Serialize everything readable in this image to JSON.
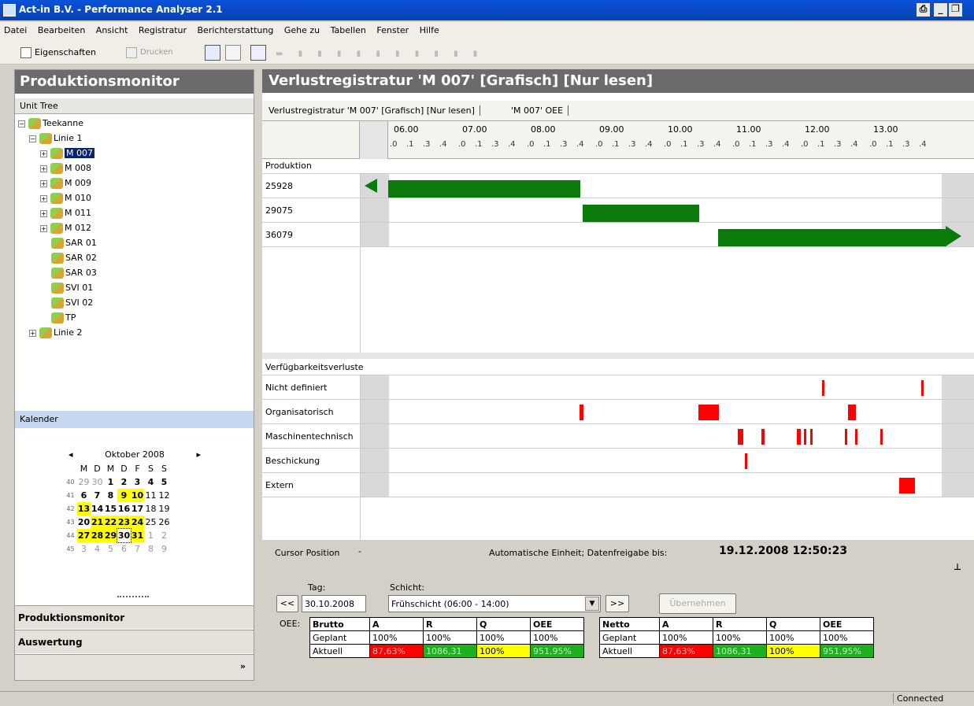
{
  "window": {
    "title": "Act-in B.V. - Performance Analyser 2.1"
  },
  "menu": [
    "Datei",
    "Bearbeiten",
    "Ansicht",
    "Registratur",
    "Berichterstattung",
    "Gehe zu",
    "Tabellen",
    "Fenster",
    "Hilfe"
  ],
  "toolbar": {
    "properties": "Eigenschaften",
    "print": "Drucken"
  },
  "left": {
    "title": "Produktionsmonitor",
    "unit_tree": "Unit Tree",
    "tree": {
      "root": "Teekanne",
      "linie1": "Linie 1",
      "items": [
        "M 007",
        "M 008",
        "M 009",
        "M 010",
        "M 011",
        "M 012",
        "SAR 01",
        "SAR 02",
        "SAR 03",
        "SVI 01",
        "SVI 02",
        "TP"
      ],
      "linie2": "Linie 2"
    },
    "kalender": "Kalender",
    "month": "Oktober 2008",
    "weekdays": [
      "M",
      "D",
      "M",
      "D",
      "F",
      "S",
      "S"
    ],
    "weeks": [
      "40",
      "41",
      "42",
      "43",
      "44",
      "45"
    ],
    "nav1": "Produktionsmonitor",
    "nav2": "Auswertung"
  },
  "right": {
    "title": "Verlustregistratur 'M 007' [Grafisch] [Nur lesen]",
    "tab1": "Verlustregistratur 'M 007' [Grafisch] [Nur lesen]",
    "tab2": "'M 007' OEE",
    "hours": [
      "06.00",
      "07.00",
      "08.00",
      "09.00",
      "10.00",
      "11.00",
      "12.00",
      "13.00"
    ],
    "subticks": [
      ".0",
      ".1",
      ".3",
      ".4"
    ],
    "section_prod": "Produktion",
    "orders": [
      "25928",
      "29075",
      "36079"
    ],
    "section_verl": "Verfügbarkeitsverluste",
    "losses": [
      "Nicht definiert",
      "Organisatorisch",
      "Maschinentechnisch",
      "Beschickung",
      "Extern"
    ]
  },
  "bottom": {
    "cursor": "Cursor Position",
    "dash": "-",
    "auto": "Automatische Einheit; Datenfreigabe bis:",
    "date": "19.12.2008 12:50:23",
    "tag_label": "Tag:",
    "schicht_label": "Schicht:",
    "prev": "<<",
    "next": ">>",
    "tag": "30.10.2008",
    "schicht": "Frühschicht (06:00 - 14:00)",
    "apply": "Übernehmen",
    "oee_label": "OEE:",
    "brutto": {
      "head": [
        "Brutto",
        "A",
        "R",
        "Q",
        "OEE"
      ],
      "geplant": [
        "Geplant",
        "100%",
        "100%",
        "100%",
        "100%"
      ],
      "aktuell": [
        "Aktuell",
        "87,63%",
        "1086,31",
        "100%",
        "951,95%"
      ]
    },
    "netto": {
      "head": [
        "Netto",
        "A",
        "R",
        "Q",
        "OEE"
      ],
      "geplant": [
        "Geplant",
        "100%",
        "100%",
        "100%",
        "100%"
      ],
      "aktuell": [
        "Aktuell",
        "87,63%",
        "1086,31",
        "100%",
        "951,95%"
      ]
    }
  },
  "status": {
    "connected": "Connected"
  }
}
